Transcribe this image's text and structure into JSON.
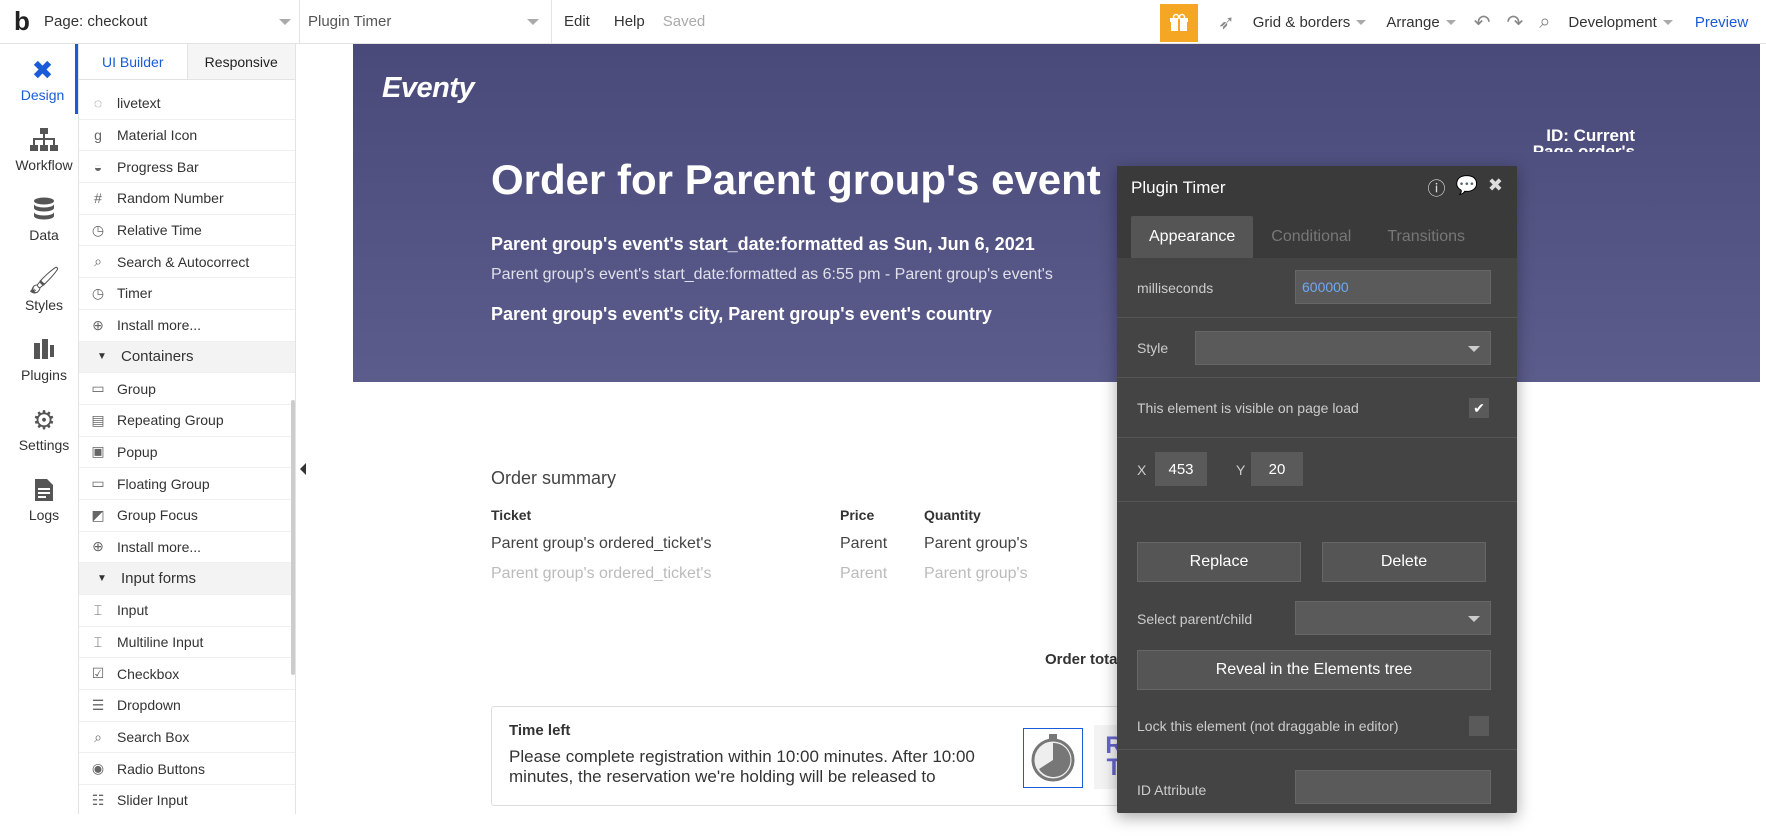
{
  "topbar": {
    "logo": "b",
    "page_select": "Page: checkout",
    "element_select": "Plugin Timer",
    "menu": [
      "Edit",
      "Help"
    ],
    "saved": "Saved",
    "grid_borders": "Grid & borders",
    "arrange": "Arrange",
    "development": "Development",
    "preview": "Preview"
  },
  "leftnav": [
    {
      "label": "Design",
      "icon": "design-icon"
    },
    {
      "label": "Workflow",
      "icon": "workflow-icon"
    },
    {
      "label": "Data",
      "icon": "data-icon"
    },
    {
      "label": "Styles",
      "icon": "styles-icon"
    },
    {
      "label": "Plugins",
      "icon": "plugins-icon"
    },
    {
      "label": "Settings",
      "icon": "settings-icon"
    },
    {
      "label": "Logs",
      "icon": "logs-icon"
    }
  ],
  "panel": {
    "tabs": [
      "UI Builder",
      "Responsive"
    ],
    "items": [
      {
        "label": "livetext",
        "icon": "◌"
      },
      {
        "label": "Material Icon",
        "icon": "g"
      },
      {
        "label": "Progress Bar",
        "icon": "◒"
      },
      {
        "label": "Random Number",
        "icon": "#"
      },
      {
        "label": "Relative Time",
        "icon": "◷"
      },
      {
        "label": "Search & Autocorrect",
        "icon": "⌕"
      },
      {
        "label": "Timer",
        "icon": "◷"
      },
      {
        "label": "Install more...",
        "icon": "⊕"
      },
      {
        "label": "Containers",
        "icon": "▼",
        "section": true
      },
      {
        "label": "Group",
        "icon": "▭"
      },
      {
        "label": "Repeating Group",
        "icon": "▤"
      },
      {
        "label": "Popup",
        "icon": "▣"
      },
      {
        "label": "Floating Group",
        "icon": "▭"
      },
      {
        "label": "Group Focus",
        "icon": "◩"
      },
      {
        "label": "Install more...",
        "icon": "⊕"
      },
      {
        "label": "Input forms",
        "icon": "▼",
        "section": true
      },
      {
        "label": "Input",
        "icon": "⌶"
      },
      {
        "label": "Multiline Input",
        "icon": "⌶"
      },
      {
        "label": "Checkbox",
        "icon": "☑"
      },
      {
        "label": "Dropdown",
        "icon": "☰"
      },
      {
        "label": "Search Box",
        "icon": "⌕"
      },
      {
        "label": "Radio Buttons",
        "icon": "◉"
      },
      {
        "label": "Slider Input",
        "icon": "☷"
      }
    ]
  },
  "hero": {
    "brand": "Eventy",
    "id_label_1": "ID: Current",
    "id_label_2": "Page order's id",
    "title": "Order for Parent group's event",
    "date": "Parent group's event's start_date:formatted as Sun, Jun 6, 2021",
    "time": "Parent group's event's start_date:formatted as 6:55 pm - Parent group's event's",
    "city": "Parent group's event's city, Parent group's event's country"
  },
  "order": {
    "heading": "Order summary",
    "columns": [
      "Ticket",
      "Price",
      "Quantity"
    ],
    "rows": [
      [
        "Parent group's ordered_ticket's",
        "Parent",
        "Parent group's"
      ],
      [
        "Parent group's ordered_ticket's",
        "Parent",
        "Parent group's"
      ]
    ],
    "total_label": "Order tota"
  },
  "timebox": {
    "title": "Time left",
    "text": "Please complete registration within 10:00 minutes. After 10:00 minutes, the reservation we're holding will be released to",
    "peek_1": "R",
    "peek_2": "T"
  },
  "dialog": {
    "title": "Plugin Timer",
    "tabs": [
      "Appearance",
      "Conditional",
      "Transitions"
    ],
    "milliseconds_label": "milliseconds",
    "milliseconds_value": "600000",
    "style_label": "Style",
    "visible_label": "This element is visible on page load",
    "x_label": "X",
    "x_value": "453",
    "y_label": "Y",
    "y_value": "20",
    "replace": "Replace",
    "delete": "Delete",
    "parent_child_label": "Select parent/child",
    "reveal": "Reveal in the Elements tree",
    "lock_label": "Lock this element (not draggable in editor)",
    "id_attr_label": "ID Attribute"
  },
  "colors": {
    "accent": "#1a5bd8",
    "hero_bg": "#52527f",
    "gift": "#f5a623",
    "dialog_bg": "#444444"
  }
}
